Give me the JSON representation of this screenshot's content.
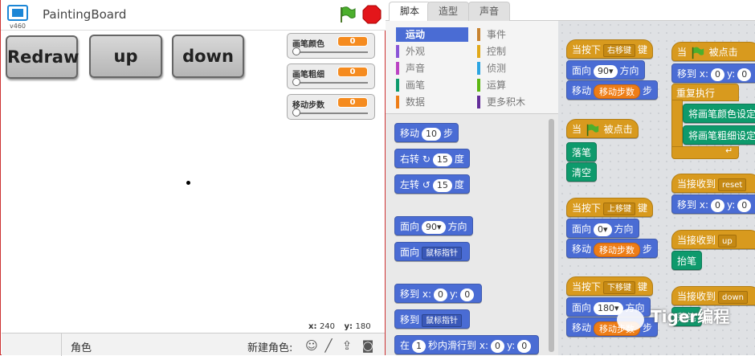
{
  "app": {
    "title": "PaintingBoard",
    "version": "v460"
  },
  "stage_buttons": [
    "Redraw",
    "up",
    "down"
  ],
  "monitors": [
    {
      "label": "画笔颜色",
      "value": "0"
    },
    {
      "label": "画笔粗细",
      "value": "0"
    },
    {
      "label": "移动步数",
      "value": "0"
    }
  ],
  "coords": {
    "x_label": "x:",
    "x": "240",
    "y_label": "y:",
    "y": "180"
  },
  "sprites": {
    "label": "角色",
    "new_sprite": "新建角色:"
  },
  "tabs": [
    "脚本",
    "造型",
    "声音"
  ],
  "categories": [
    {
      "label": "运动",
      "color": "#4a6cd4"
    },
    {
      "label": "事件",
      "color": "#c88330"
    },
    {
      "label": "外观",
      "color": "#8a55d7"
    },
    {
      "label": "控制",
      "color": "#e1a91a"
    },
    {
      "label": "声音",
      "color": "#bb42c3"
    },
    {
      "label": "侦测",
      "color": "#2ca5e2"
    },
    {
      "label": "画笔",
      "color": "#0e9a6c"
    },
    {
      "label": "运算",
      "color": "#5cb712"
    },
    {
      "label": "数据",
      "color": "#ee7d16"
    },
    {
      "label": "更多积木",
      "color": "#632d99"
    }
  ],
  "palette": {
    "move": {
      "text": "移动",
      "val": "10",
      "suffix": "步"
    },
    "turn_right": {
      "text": "右转",
      "val": "15",
      "suffix": "度"
    },
    "turn_left": {
      "text": "左转",
      "val": "15",
      "suffix": "度"
    },
    "point_dir": {
      "text": "面向",
      "val": "90▾",
      "suffix": "方向"
    },
    "point_to": {
      "text": "面向",
      "dd": "鼠标指针"
    },
    "goto_xy": {
      "text": "移到",
      "x_label": "x:",
      "x": "0",
      "y_label": "y:",
      "y": "0"
    },
    "goto": {
      "text": "移到",
      "dd": "鼠标指针"
    },
    "glide": {
      "text": "在",
      "val": "1",
      "mid": "秒内滑行到",
      "x_label": "x:",
      "x": "0",
      "y_label": "y:",
      "y": "0"
    }
  },
  "scripts": {
    "right": {
      "hat": "当按下",
      "key": "右移键",
      "hat_suffix": "键",
      "face": "面向",
      "dir": "90▾",
      "dir_suffix": "方向",
      "move": "移动",
      "var": "移动步数",
      "step": "步"
    },
    "flag1": {
      "hat": "当",
      "hat_suffix": "被点击",
      "pendown": "落笔",
      "clear": "清空"
    },
    "up": {
      "hat": "当按下",
      "key": "上移键",
      "hat_suffix": "键",
      "face": "面向",
      "dir": "0▾",
      "dir_suffix": "方向",
      "move": "移动",
      "var": "移动步数",
      "step": "步"
    },
    "down": {
      "hat": "当按下",
      "key": "下移键",
      "hat_suffix": "键",
      "face": "面向",
      "dir": "180▾",
      "dir_suffix": "方向",
      "move": "移动",
      "var": "移动步数",
      "step": "步"
    },
    "flag2": {
      "hat": "当",
      "hat_suffix": "被点击",
      "goto": "移到",
      "x_label": "x:",
      "x": "0",
      "y_label": "y:",
      "y": "0",
      "forever": "重复执行",
      "set_color": "将画笔颜色设定",
      "set_size": "将画笔粗细设定"
    },
    "recv_reset": {
      "hat": "当接收到",
      "msg": "reset",
      "goto": "移到",
      "x_label": "x:",
      "x": "0",
      "y_label": "y:",
      "y": "0"
    },
    "recv_up": {
      "hat": "当接收到",
      "msg": "up",
      "penup": "抬笔"
    },
    "recv_down": {
      "hat": "当接收到",
      "msg": "down",
      "pendown": "落笔"
    }
  },
  "watermark": "Tiger编程"
}
